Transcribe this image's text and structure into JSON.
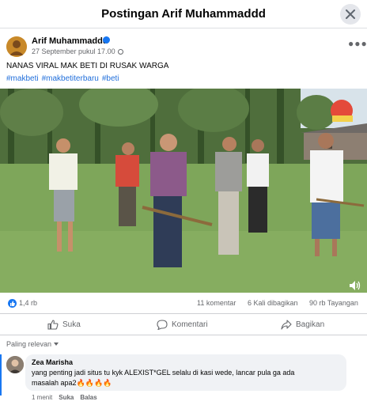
{
  "modal": {
    "title": "Postingan Arif Muhammaddd"
  },
  "post": {
    "author": "Arif Muhammaddd",
    "timestamp": "27 September pukul 17.00",
    "more_icon": "more-horizontal-icon",
    "text": "NANAS VIRAL MAK BETI DI RUSAK WARGA",
    "hashtags": [
      "#makbeti",
      "#makbetiterbaru",
      "#beti"
    ]
  },
  "stats": {
    "likes": "1,4 rb",
    "comments": "11 komentar",
    "shares": "6 Kali dibagikan",
    "views": "90 rb Tayangan"
  },
  "actions": {
    "like": "Suka",
    "comment": "Komentari",
    "share": "Bagikan"
  },
  "comments_sort": "Paling relevan",
  "comment": {
    "author": "Zea Marisha",
    "text_line1": "yang penting jadi situs tu kyk ALEXIST*GEL selalu di kasi wede, lancar pula ga ada",
    "text_line2": "masalah apa2🔥🔥🔥🔥",
    "time": "1 menit",
    "like": "Suka",
    "reply": "Balas"
  },
  "colors": {
    "accent": "#1877f2",
    "secondary_text": "#65676b",
    "link": "#216fdb"
  }
}
